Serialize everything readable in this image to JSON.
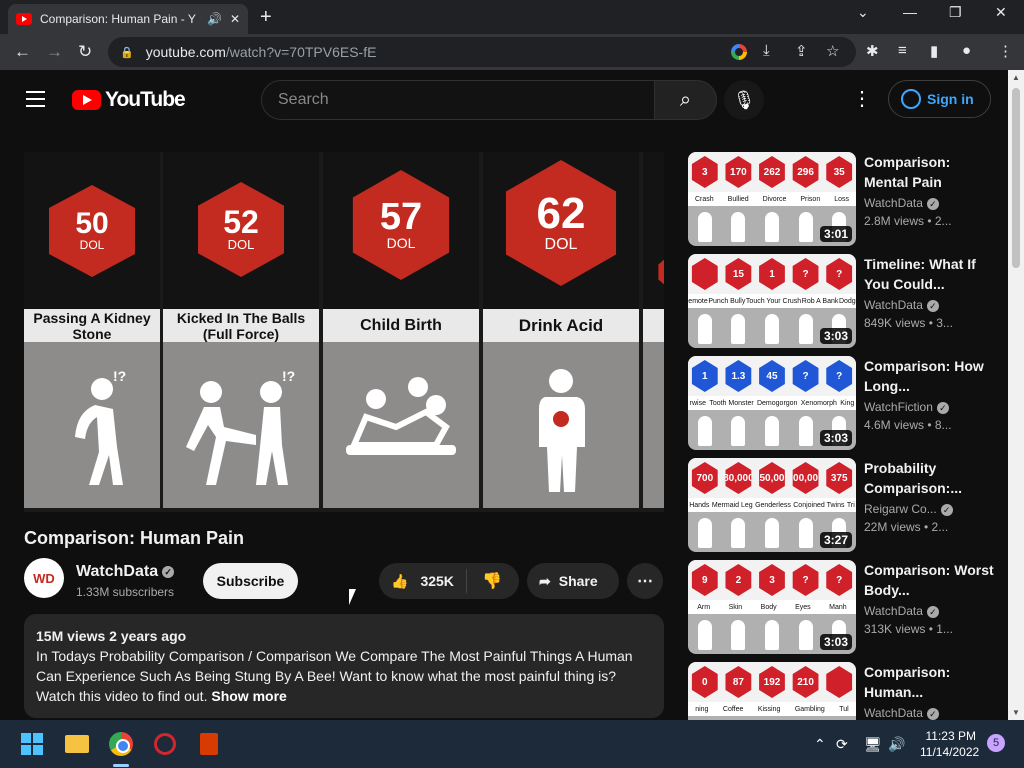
{
  "browser": {
    "tab_title": "Comparison: Human Pain - Y",
    "url_host": "youtube.com",
    "url_path": "/watch?v=70TPV6ES-fE",
    "new_tab": "+",
    "close": "✕"
  },
  "youtube": {
    "logo": "YouTube",
    "search_placeholder": "Search",
    "sign_in": "Sign in"
  },
  "player": {
    "items": [
      {
        "value": "50",
        "unit": "DOL",
        "label": "Passing A Kidney Stone"
      },
      {
        "value": "52",
        "unit": "DOL",
        "label": "Kicked In The Balls (Full Force)"
      },
      {
        "value": "57",
        "unit": "DOL",
        "label": "Child Birth"
      },
      {
        "value": "62",
        "unit": "DOL",
        "label": "Drink Acid"
      }
    ]
  },
  "video": {
    "title": "Comparison: Human Pain",
    "channel": "WatchData",
    "channel_avatar": "WD",
    "subscribers": "1.33M subscribers",
    "subscribe": "Subscribe",
    "likes": "325K",
    "share": "Share",
    "views_date": "15M views  2 years ago",
    "description": "In Todays Probability Comparison / Comparison We Compare The Most Painful Things A Human Can Experience Such As Being Stung By A Bee! Want to know what the most painful thing is? Watch this video to find out.",
    "show_more": "Show more"
  },
  "sidebar": [
    {
      "title": "Comparison: Mental Pain",
      "channel": "WatchData",
      "stats": "2.8M views • 2...",
      "duration": "3:01",
      "hexes": [
        "3",
        "170",
        "262",
        "296",
        "35"
      ],
      "labels": [
        "Crash",
        "Bullied",
        "Divorce",
        "Prison",
        "Loss"
      ],
      "blue": false
    },
    {
      "title": "Timeline: What If You Could...",
      "channel": "WatchData",
      "stats": "849K views • 3...",
      "duration": "3:03",
      "hexes": [
        "",
        "15",
        "1",
        "?",
        "?"
      ],
      "labels": [
        "emote",
        "Punch Bully",
        "Touch Your Crush",
        "Rob A Bank",
        "Dodg"
      ],
      "blue": false
    },
    {
      "title": "Comparison: How Long...",
      "channel": "WatchFiction",
      "stats": "4.6M views • 8...",
      "duration": "3:03",
      "hexes": [
        "1",
        "1.3",
        "45",
        "?",
        "?"
      ],
      "labels": [
        "rwise",
        "Tooth Monster",
        "Demogorgon",
        "Xenomorph",
        "King"
      ],
      "blue": true
    },
    {
      "title": "Probability Comparison:...",
      "channel": "Reigarw Co...",
      "stats": "22M views • 2...",
      "duration": "3:27",
      "hexes": [
        "700",
        "80,000",
        "150,000",
        "200,000",
        "375"
      ],
      "labels": [
        "Hands",
        "Mermaid Leg",
        "Genderless",
        "Conjoined Twins",
        "Tri"
      ],
      "blue": false
    },
    {
      "title": "Comparison: Worst Body...",
      "channel": "WatchData",
      "stats": "313K views • 1...",
      "duration": "3:03",
      "hexes": [
        "9",
        "2",
        "3",
        "?",
        "?"
      ],
      "labels": [
        "Arm",
        "Skin",
        "Body",
        "Eyes",
        "Manh"
      ],
      "blue": false
    },
    {
      "title": "Comparison: Human...",
      "channel": "WatchData",
      "stats": "",
      "duration": "",
      "hexes": [
        "0",
        "87",
        "192",
        "210",
        ""
      ],
      "labels": [
        "ning",
        "Coffee",
        "Kissing",
        "Gambling",
        "Tul"
      ],
      "blue": false
    }
  ],
  "taskbar": {
    "time": "11:23 PM",
    "date": "11/14/2022",
    "notifications": "5"
  }
}
